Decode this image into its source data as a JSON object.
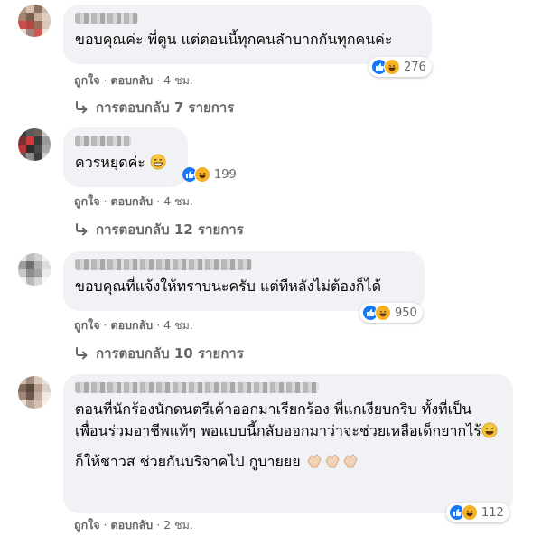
{
  "comments": [
    {
      "text": "ขอบคุณค่ะ พี่ตูน แต่ตอนนี้ทุกคนลำบากกันทุกคนค่ะ",
      "reaction_count": "276",
      "like_label": "ถูกใจ",
      "reply_label": "ตอบกลับ",
      "time": "4 ชม.",
      "replies_label": "การตอบกลับ 7 รายการ"
    },
    {
      "text": "ควรหยุดค่ะ",
      "reaction_count": "199",
      "like_label": "ถูกใจ",
      "reply_label": "ตอบกลับ",
      "time": "4 ชม.",
      "replies_label": "การตอบกลับ 12 รายการ"
    },
    {
      "text": "ขอบคุณที่แจ้งให้ทราบนะครับ แต่ทีหลังไม่ต้องก็ได้",
      "reaction_count": "950",
      "like_label": "ถูกใจ",
      "reply_label": "ตอบกลับ",
      "time": "4 ชม.",
      "replies_label": "การตอบกลับ 10 รายการ"
    },
    {
      "text": "ตอนที่นักร้องนักดนตรีเค้าออกมาเรียกร้อง พี่แกเงียบกริบ ทั้งที่เป็นเพื่อนร่วมอาชีพแท้ๆ พอแบบนี้กลับออกมาว่าจะช่วยเหลือเด็กยากไร้",
      "text2": "ก็ให้ชาวส ช่วยกันบริจาคไป กูบายยย",
      "reaction_count": "112",
      "like_label": "ถูกใจ",
      "reply_label": "ตอบกลับ",
      "time": "2 ชม."
    }
  ],
  "colors": {
    "bubble": "#f0f2f5",
    "meta_text": "#65676b",
    "like_blue": "#1877f2",
    "haha_yellow": "#f7b125"
  },
  "icons": [
    "like-reaction-icon",
    "haha-reaction-icon",
    "reply-arrow-icon",
    "grin-emoji-icon",
    "clap-emoji-icon"
  ]
}
